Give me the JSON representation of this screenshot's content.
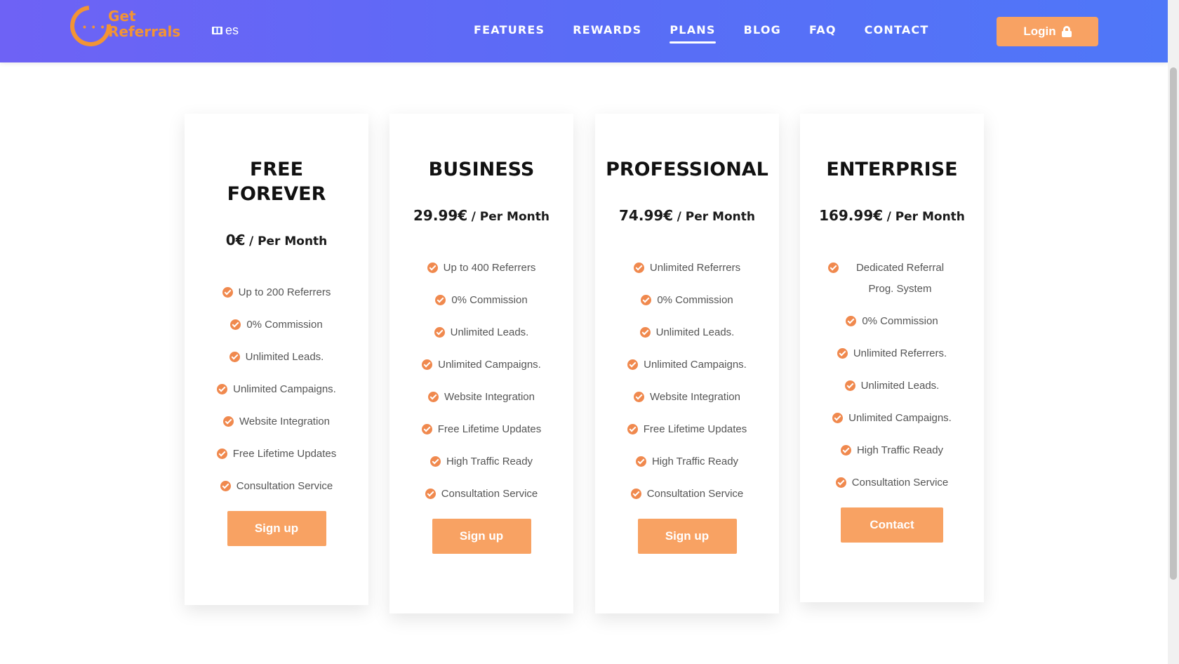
{
  "header": {
    "logo_text": [
      "Get",
      "Referrals"
    ],
    "language": {
      "code": "es"
    },
    "nav": [
      {
        "label": "FEATURES",
        "active": false
      },
      {
        "label": "REWARDS",
        "active": false
      },
      {
        "label": "PLANS",
        "active": true
      },
      {
        "label": "BLOG",
        "active": false
      },
      {
        "label": "FAQ",
        "active": false
      },
      {
        "label": "CONTACT",
        "active": false
      }
    ],
    "login_label": "Login"
  },
  "colors": {
    "header_gradient_start": "#6e62f5",
    "header_gradient_end": "#4f77f8",
    "accent": "#f8a263",
    "check": "#f0894e"
  },
  "plans": [
    {
      "title_lines": [
        "FREE",
        "FOREVER"
      ],
      "price": "0€",
      "period": "/ Per Month",
      "features": [
        "Up to 200 Referrers",
        "0% Commission",
        "Unlimited Leads.",
        "Unlimited Campaigns.",
        "Website Integration",
        "Free Lifetime Updates",
        "Consultation Service"
      ],
      "button": "Sign up"
    },
    {
      "title_lines": [
        "BUSINESS"
      ],
      "price": "29.99€",
      "period": "/ Per Month",
      "features": [
        "Up to 400 Referrers",
        "0% Commission",
        "Unlimited Leads.",
        "Unlimited Campaigns.",
        "Website Integration",
        "Free Lifetime Updates",
        "High Traffic Ready",
        "Consultation Service"
      ],
      "button": "Sign up"
    },
    {
      "title_lines": [
        "PROFESSIONAL"
      ],
      "price": "74.99€",
      "period": "/ Per Month",
      "features": [
        "Unlimited Referrers",
        "0% Commission",
        "Unlimited Leads.",
        "Unlimited Campaigns.",
        "Website Integration",
        "Free Lifetime Updates",
        "High Traffic Ready",
        "Consultation Service"
      ],
      "button": "Sign up"
    },
    {
      "title_lines": [
        "ENTERPRISE"
      ],
      "price": "169.99€",
      "period": "/ Per Month",
      "features": [
        "Dedicated Referral Prog. System",
        "0% Commission",
        "Unlimited Referrers.",
        "Unlimited Leads.",
        "Unlimited Campaigns.",
        "High Traffic Ready",
        "Consultation Service"
      ],
      "button": "Contact"
    }
  ]
}
